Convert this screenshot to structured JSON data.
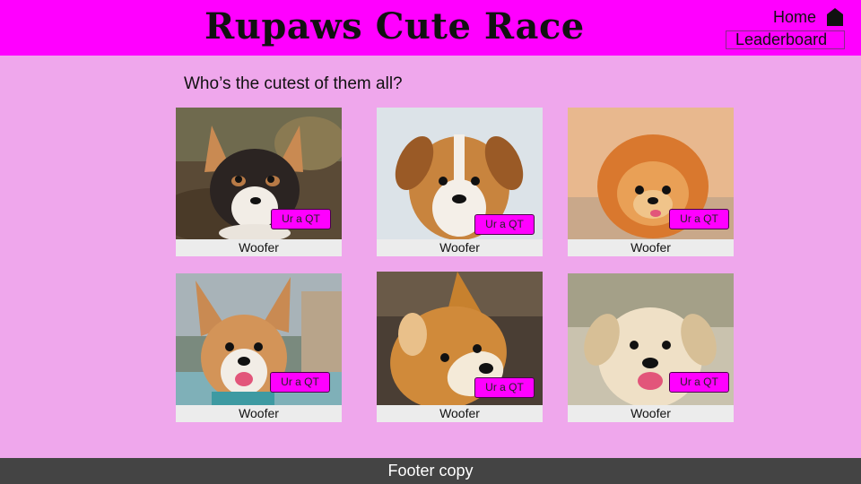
{
  "header": {
    "title": "Rupaws Cute Race",
    "home_label": "Home",
    "home_icon": "home-icon",
    "leaderboard_label": "Leaderboard"
  },
  "main": {
    "prompt": "Who’s the cutest of them all?",
    "cards": [
      {
        "caption": "Woofer",
        "button_label": "Ur a QT"
      },
      {
        "caption": "Woofer",
        "button_label": "Ur a QT"
      },
      {
        "caption": "Woofer",
        "button_label": "Ur a QT"
      },
      {
        "caption": "Woofer",
        "button_label": "Ur a QT"
      },
      {
        "caption": "Woofer",
        "button_label": "Ur a QT"
      },
      {
        "caption": "Woofer",
        "button_label": "Ur a QT"
      }
    ]
  },
  "footer": {
    "copy": "Footer copy"
  },
  "colors": {
    "header_bg": "#ff00ff",
    "page_bg": "#efa7ec",
    "button_bg": "#ff00ff",
    "footer_bg": "#444444"
  }
}
